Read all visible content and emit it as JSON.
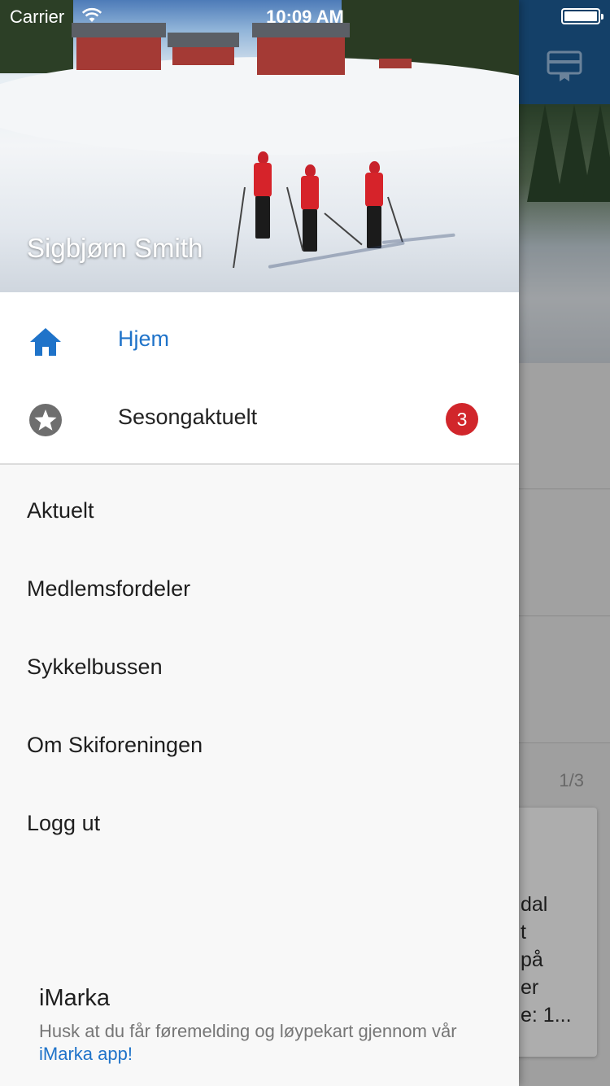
{
  "status_bar": {
    "carrier": "Carrier",
    "time": "10:09 AM",
    "battery_level": 1.0
  },
  "drawer": {
    "user_name": "Sigbjørn Smith",
    "primary_items": [
      {
        "label": "Hjem",
        "icon": "home-icon",
        "active": true
      },
      {
        "label": "Sesongaktuelt",
        "icon": "star-circle-icon",
        "badge": "3"
      }
    ],
    "secondary_items": [
      {
        "label": "Aktuelt"
      },
      {
        "label": "Medlemsfordeler"
      },
      {
        "label": "Sykkelbussen"
      },
      {
        "label": "Om Skiforeningen"
      },
      {
        "label": "Logg ut"
      }
    ],
    "footer": {
      "title": "iMarka",
      "text": "Husk at du får føremelding og løypekart gjennom vår",
      "link": "iMarka app!"
    }
  },
  "background": {
    "header_icon": "card-icon",
    "pager": "1/3",
    "slide_text": "dal\nt\npå\ner\ne: 1..."
  },
  "colors": {
    "accent": "#1f73c9",
    "header_blue": "#1e5f9a",
    "badge_red": "#d1262b"
  }
}
